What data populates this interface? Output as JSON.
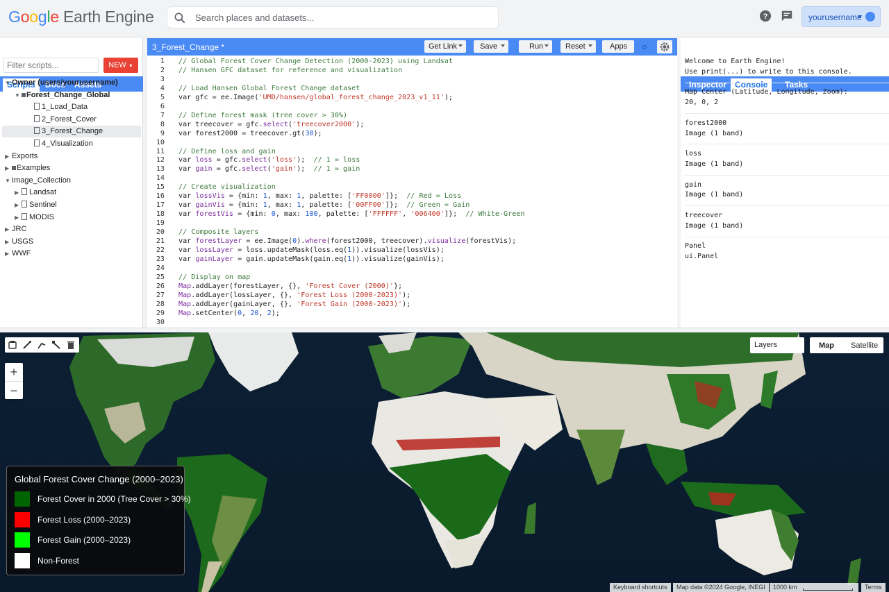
{
  "app": {
    "logo_google": "Google",
    "logo_product": "Earth Engine"
  },
  "search": {
    "placeholder": "Search places and datasets..."
  },
  "user": {
    "name": "yourusername"
  },
  "left_tabs": [
    "Scripts",
    "Docs",
    "Assets"
  ],
  "scripts": {
    "filter_placeholder": "Filter scripts...",
    "new_label": "NEW",
    "tree": [
      {
        "label": "Owner (users/yourusername)",
        "indent": 0,
        "kind": "owner",
        "expanded": true
      },
      {
        "label": "Forest_Change_Global",
        "indent": 1,
        "kind": "folder",
        "expanded": true
      },
      {
        "label": "1_Load_Data",
        "indent": 2,
        "kind": "file"
      },
      {
        "label": "2_Forest_Cover",
        "indent": 2,
        "kind": "file"
      },
      {
        "label": "3_Forest_Change",
        "indent": 2,
        "kind": "file",
        "selected": true
      },
      {
        "label": "4_Visualization",
        "indent": 2,
        "kind": "file"
      },
      {
        "label": "Exports",
        "indent": 0,
        "kind": "group"
      },
      {
        "label": "Examples",
        "indent": 0,
        "kind": "group-folder"
      },
      {
        "label": "Image_Collection",
        "indent": 0,
        "kind": "group",
        "expanded": true
      },
      {
        "label": "Landsat",
        "indent": 1,
        "kind": "file-group"
      },
      {
        "label": "Sentinel",
        "indent": 1,
        "kind": "file-group"
      },
      {
        "label": "MODIS",
        "indent": 1,
        "kind": "file-group"
      },
      {
        "label": "JRC",
        "indent": 0,
        "kind": "group"
      },
      {
        "label": "USGS",
        "indent": 0,
        "kind": "group"
      },
      {
        "label": "WWF",
        "indent": 0,
        "kind": "group"
      }
    ]
  },
  "editor": {
    "title": "3_Forest_Change *",
    "buttons": [
      "Get Link",
      "Save",
      "Run",
      "Reset",
      "Apps"
    ],
    "lines": [
      [
        [
          "cm",
          "// Global Forest Cover Change Detection (2000-2023) using Landsat"
        ]
      ],
      [
        [
          "cm",
          "// Hansen GFC dataset for reference and visualization"
        ]
      ],
      [],
      [
        [
          "cm",
          "// Load Hansen Global Forest Change dataset"
        ]
      ],
      [
        [
          "tx",
          "var gfc = ee.Image("
        ],
        [
          "st",
          "'UMD/hansen/global_forest_change_2023_v1_11'"
        ],
        [
          "tx",
          ");"
        ]
      ],
      [],
      [
        [
          "cm",
          "// Define forest mask (tree cover > 30%)"
        ]
      ],
      [
        [
          "tx",
          "var treecover = gfc."
        ],
        [
          "kw",
          "select"
        ],
        [
          "tx",
          "("
        ],
        [
          "st",
          "'treecover2000'"
        ],
        [
          "tx",
          ");"
        ]
      ],
      [
        [
          "tx",
          "var forest2000 = treecover.gt("
        ],
        [
          "nu",
          "30"
        ],
        [
          "tx",
          ");"
        ]
      ],
      [],
      [
        [
          "cm",
          "// Define loss and gain"
        ]
      ],
      [
        [
          "tx",
          "var "
        ],
        [
          "kw",
          "loss"
        ],
        [
          "tx",
          " = gfc."
        ],
        [
          "kw",
          "select"
        ],
        [
          "tx",
          "("
        ],
        [
          "st",
          "'loss'"
        ],
        [
          "tx",
          ");  "
        ],
        [
          "cm",
          "// 1 = loss"
        ]
      ],
      [
        [
          "tx",
          "var "
        ],
        [
          "kw",
          "gain"
        ],
        [
          "tx",
          " = gfc."
        ],
        [
          "kw",
          "select"
        ],
        [
          "tx",
          "("
        ],
        [
          "st",
          "'gain'"
        ],
        [
          "tx",
          ");  "
        ],
        [
          "cm",
          "// 1 = gain"
        ]
      ],
      [],
      [
        [
          "cm",
          "// Create visualization"
        ]
      ],
      [
        [
          "tx",
          "var "
        ],
        [
          "kw",
          "lossVis"
        ],
        [
          "tx",
          " = {min: "
        ],
        [
          "nu",
          "1"
        ],
        [
          "tx",
          ", max: "
        ],
        [
          "nu",
          "1"
        ],
        [
          "tx",
          ", palette: ["
        ],
        [
          "st",
          "'FF0000'"
        ],
        [
          "tx",
          "]};  "
        ],
        [
          "cm",
          "// Red = Loss"
        ]
      ],
      [
        [
          "tx",
          "var "
        ],
        [
          "kw",
          "gainVis"
        ],
        [
          "tx",
          " = {min: "
        ],
        [
          "nu",
          "1"
        ],
        [
          "tx",
          ", max: "
        ],
        [
          "nu",
          "1"
        ],
        [
          "tx",
          ", palette: ["
        ],
        [
          "st",
          "'00FF00'"
        ],
        [
          "tx",
          "]};  "
        ],
        [
          "cm",
          "// Green = Gain"
        ]
      ],
      [
        [
          "tx",
          "var "
        ],
        [
          "kw",
          "forestVis"
        ],
        [
          "tx",
          " = {min: "
        ],
        [
          "nu",
          "0"
        ],
        [
          "tx",
          ", max: "
        ],
        [
          "nu",
          "100"
        ],
        [
          "tx",
          ", palette: ["
        ],
        [
          "st",
          "'FFFFFF'"
        ],
        [
          "tx",
          ", "
        ],
        [
          "st",
          "'006400'"
        ],
        [
          "tx",
          "]};  "
        ],
        [
          "cm",
          "// White-Green"
        ]
      ],
      [],
      [
        [
          "cm",
          "// Composite layers"
        ]
      ],
      [
        [
          "tx",
          "var "
        ],
        [
          "kw",
          "forestLayer"
        ],
        [
          "tx",
          " = ee.Image("
        ],
        [
          "nu",
          "0"
        ],
        [
          "tx",
          ")."
        ],
        [
          "kw",
          "where"
        ],
        [
          "tx",
          "(forest2000, treecover)."
        ],
        [
          "kw",
          "visualize"
        ],
        [
          "tx",
          "(forestVis);"
        ]
      ],
      [
        [
          "tx",
          "var "
        ],
        [
          "kw",
          "lossLayer"
        ],
        [
          "tx",
          " = loss.updateMask(loss.eq("
        ],
        [
          "nu",
          "1"
        ],
        [
          "tx",
          ")).visualize(lossVis);"
        ]
      ],
      [
        [
          "tx",
          "var "
        ],
        [
          "kw",
          "gainLayer"
        ],
        [
          "tx",
          " = gain.updateMask(gain.eq("
        ],
        [
          "nu",
          "1"
        ],
        [
          "tx",
          ")).visualize(gainVis);"
        ]
      ],
      [],
      [
        [
          "cm",
          "// Display on map"
        ]
      ],
      [
        [
          "kw",
          "Map"
        ],
        [
          "tx",
          ".addLayer(forestLayer, {}, "
        ],
        [
          "st",
          "'Forest Cover (2000)'"
        ],
        [
          "tx",
          "};"
        ]
      ],
      [
        [
          "kw",
          "Map"
        ],
        [
          "tx",
          ".addLayer(lossLayer, {}, "
        ],
        [
          "st",
          "'Forest Loss (2000-2023)'"
        ],
        [
          "tx",
          ");"
        ]
      ],
      [
        [
          "kw",
          "Map"
        ],
        [
          "tx",
          ".addLayer(gainLayer, {}, "
        ],
        [
          "st",
          "'Forest Gain (2000-2023)'"
        ],
        [
          "tx",
          ");"
        ]
      ],
      [
        [
          "kw",
          "Map"
        ],
        [
          "tx",
          ".setCenter("
        ],
        [
          "nu",
          "0"
        ],
        [
          "tx",
          ", "
        ],
        [
          "nu",
          "20"
        ],
        [
          "tx",
          ", "
        ],
        [
          "nu",
          "2"
        ],
        [
          "tx",
          ");"
        ]
      ],
      []
    ]
  },
  "right_tabs": [
    "Inspector",
    "Console",
    "Tasks"
  ],
  "console": {
    "lines": [
      "Welcome to Earth Engine!",
      "Use print(...) to write to this console.",
      "",
      "Map Center (Latitude, Longitude, Zoom):",
      " 20, 0, 2",
      "",
      "forest2000",
      " Image (1 band)",
      "",
      "loss",
      " Image (1 band)",
      "",
      "gain",
      " Image (1 band)",
      "",
      "treecover",
      " Image (1 band)",
      "",
      "Panel",
      "ui.Panel"
    ]
  },
  "map": {
    "zoom_in": "+",
    "zoom_out": "−",
    "layers_label": "Layers",
    "map_type": [
      "Map",
      "Satellite"
    ],
    "legend": {
      "title": "Global Forest Cover Change (2000–2023)",
      "items": [
        {
          "label": "Forest Cover in 2000 (Tree Cover > 30%)",
          "color": "#006400"
        },
        {
          "label": "Forest Loss (2000–2023)",
          "color": "#ff0000"
        },
        {
          "label": "Forest Gain (2000–2023)",
          "color": "#00ff00"
        },
        {
          "label": "Non-Forest",
          "color": "#ffffff"
        }
      ]
    },
    "attribution": [
      "Keyboard shortcuts",
      "Map data ©2024 Google, INEGI",
      "1000 km",
      "Terms"
    ]
  }
}
